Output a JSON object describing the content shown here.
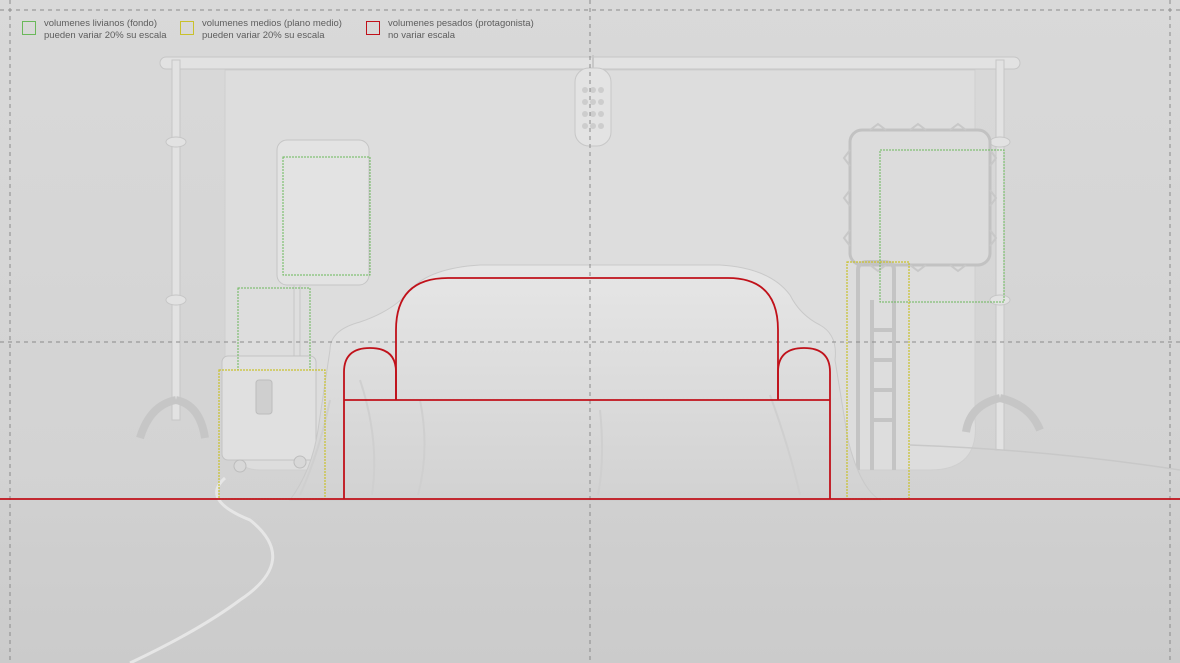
{
  "legend": [
    {
      "line1": "volumenes livianos (fondo)",
      "line2": "pueden variar 20% su escala",
      "color": "#6ab85a"
    },
    {
      "line1": "volumenes medios (plano medio)",
      "line2": "pueden variar 20% su escala",
      "color": "#c9c12c"
    },
    {
      "line1": "volumenes pesados (protagonista)",
      "line2": "no variar escala",
      "color": "#c0111a"
    }
  ]
}
